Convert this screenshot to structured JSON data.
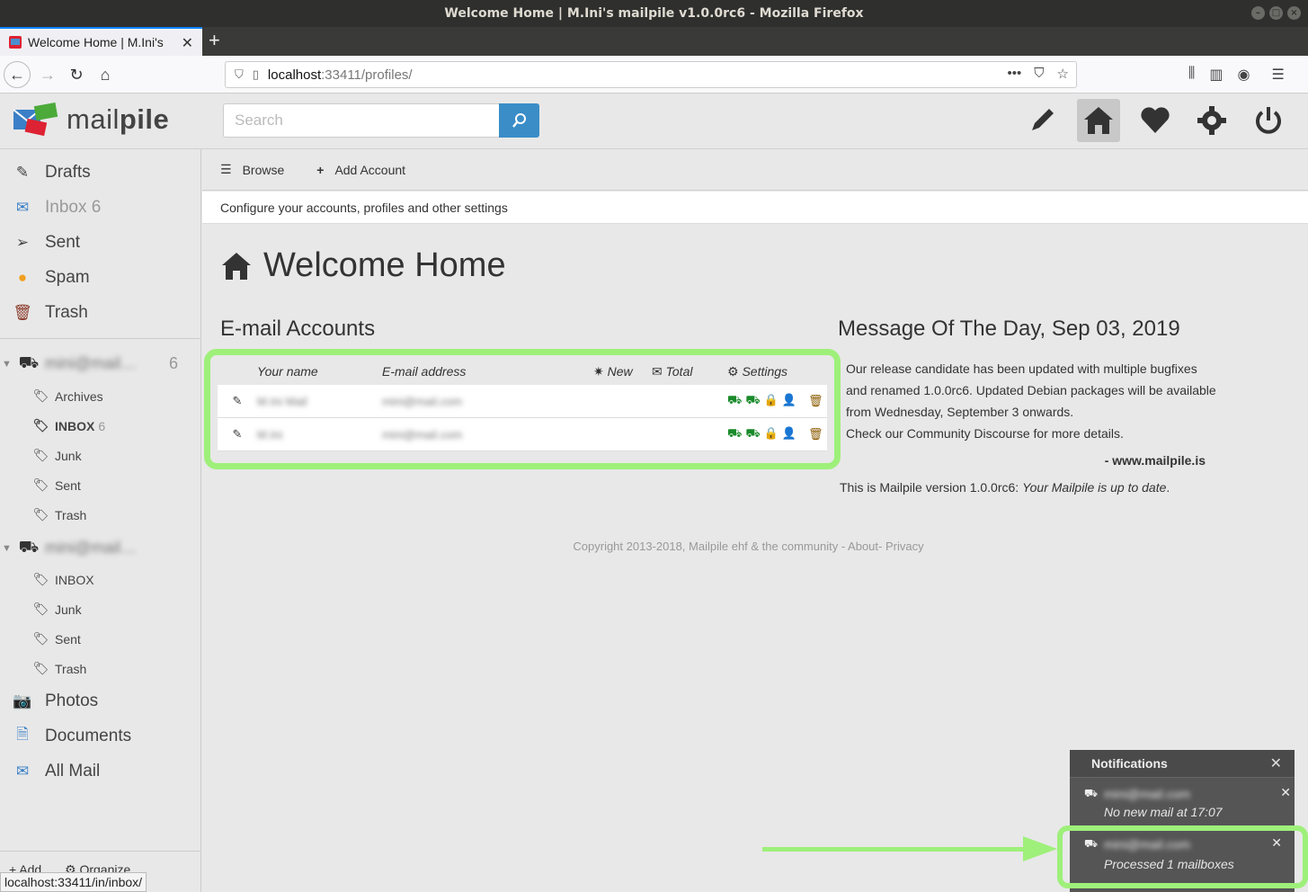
{
  "window": {
    "title": "Welcome Home | M.Ini's mailpile v1.0.0rc6 - Mozilla Firefox"
  },
  "browser": {
    "tab_title": "Welcome Home | M.Ini's",
    "url_host": "localhost",
    "url_rest": ":33411/profiles/",
    "status_url": "localhost:33411/in/inbox/"
  },
  "app": {
    "logo_light": "mail",
    "logo_bold": "pile",
    "search_placeholder": "Search"
  },
  "sidebar": {
    "main_items": [
      {
        "label": "Drafts",
        "icon": "pencil-icon"
      },
      {
        "label": "Inbox 6",
        "icon": "envelope-icon"
      },
      {
        "label": "Sent",
        "icon": "paper-plane-icon"
      },
      {
        "label": "Spam",
        "icon": "spam-icon"
      },
      {
        "label": "Trash",
        "icon": "trash-icon"
      }
    ],
    "accounts": [
      {
        "name": "mini@mail…",
        "count": "6",
        "tags": [
          {
            "label": "Archives",
            "count": ""
          },
          {
            "label": "INBOX",
            "count": "6",
            "bold": true
          },
          {
            "label": "Junk",
            "count": ""
          },
          {
            "label": "Sent",
            "count": ""
          },
          {
            "label": "Trash",
            "count": ""
          }
        ]
      },
      {
        "name": "mini@mail…",
        "count": "",
        "tags": [
          {
            "label": "INBOX",
            "count": ""
          },
          {
            "label": "Junk",
            "count": ""
          },
          {
            "label": "Sent",
            "count": ""
          },
          {
            "label": "Trash",
            "count": ""
          }
        ]
      }
    ],
    "bottom_items": [
      {
        "label": "Photos",
        "icon": "camera-icon"
      },
      {
        "label": "Documents",
        "icon": "document-icon"
      },
      {
        "label": "All Mail",
        "icon": "all-mail-icon"
      }
    ],
    "footer_add": "Add",
    "footer_organize": "Organize"
  },
  "main": {
    "subnav_browse": "Browse",
    "subnav_add": "Add Account",
    "info": "Configure your accounts, profiles and other settings",
    "title": "Welcome Home",
    "accounts_heading": "E-mail Accounts",
    "table_headers": {
      "name": "Your name",
      "email": "E-mail address",
      "new": "New",
      "total": "Total",
      "settings": "Settings"
    },
    "accounts": [
      {
        "name": "M.Ini Mail",
        "email": "mini@mail.com"
      },
      {
        "name": "M.Ini",
        "email": "mini@mail.com"
      }
    ],
    "motd_heading": "Message Of The Day, Sep 03, 2019",
    "motd_lines": [
      "Our release candidate has been updated with multiple bugfixes",
      "and renamed 1.0.0rc6. Updated Debian packages will be available",
      "from Wednesday, September 3 onwards.",
      "Check our Community Discourse for more details."
    ],
    "motd_signature": "- www.mailpile.is",
    "version_prefix": "This is Mailpile version 1.0.0rc6: ",
    "version_status": "Your Mailpile is up to date",
    "version_suffix": ".",
    "copyright": "Copyright 2013-2018, Mailpile ehf & the community - About- Privacy"
  },
  "notifications": {
    "title": "Notifications",
    "items": [
      {
        "account": "mini@mail.com",
        "message": "No new mail at 17:07"
      },
      {
        "account": "mini@mail.com",
        "message": "Processed 1 mailboxes"
      }
    ]
  },
  "colors": {
    "accent": "#3a8dc7",
    "highlight": "#9ef07a",
    "settings_green": "#1a8a2a",
    "trash_brown": "#8a5a00"
  }
}
